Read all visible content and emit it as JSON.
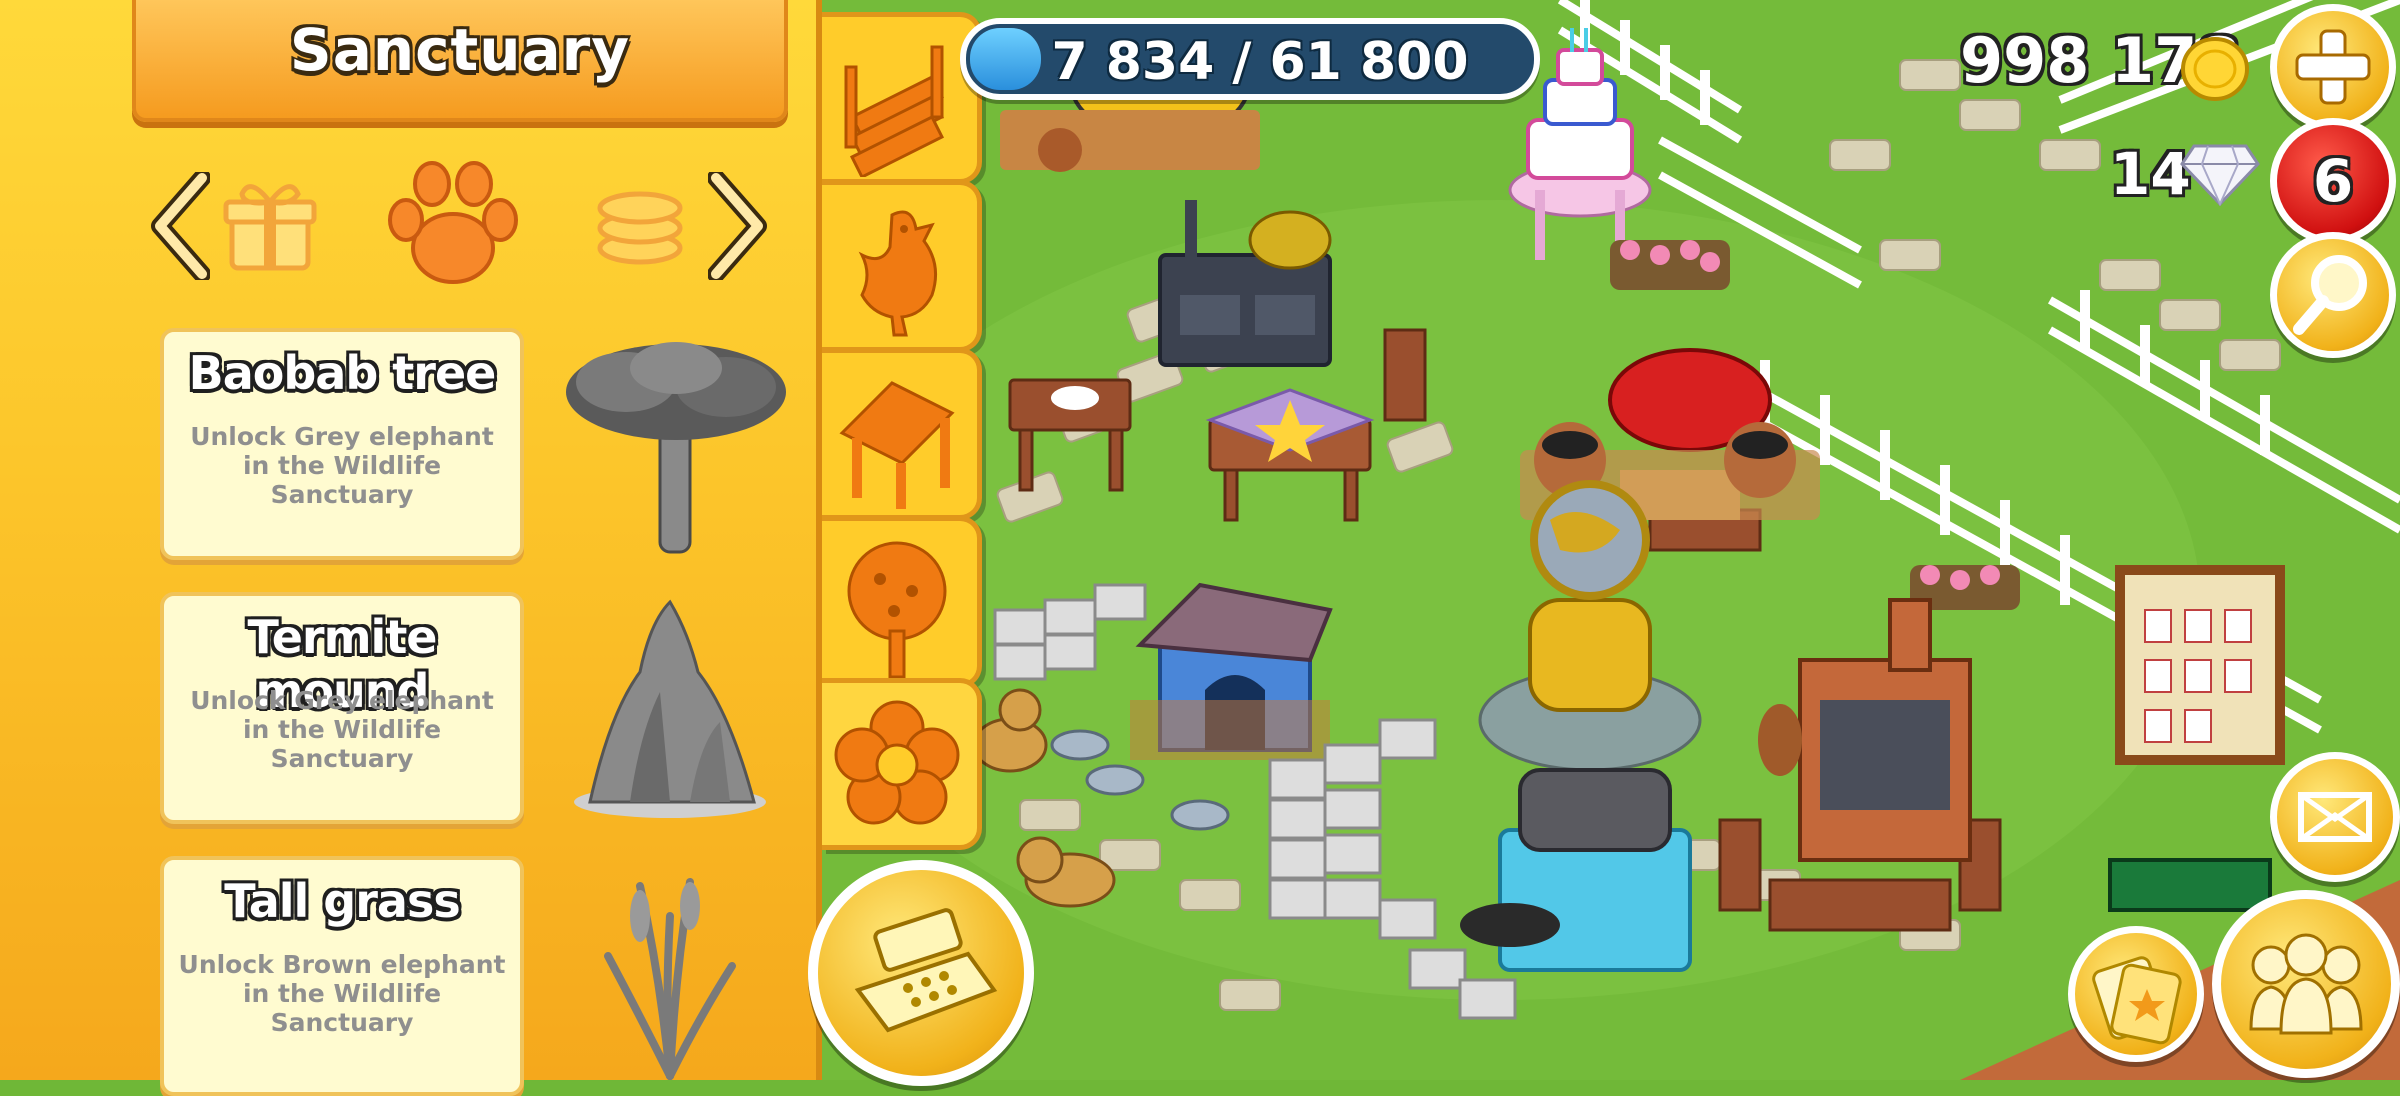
{
  "shop": {
    "title": "Sanctuary",
    "categories": [
      "gift-icon",
      "paw-icon",
      "coins-icon"
    ],
    "active_category": "paw-icon",
    "items": [
      {
        "name": "Baobab tree",
        "description": "Unlock Grey elephant in the Wildlife Sanctuary",
        "icon": "baobab-tree-icon"
      },
      {
        "name": "Termite mound",
        "description": "Unlock Grey elephant in the Wildlife Sanctuary",
        "icon": "termite-mound-icon"
      },
      {
        "name": "Tall grass",
        "description": "Unlock Brown elephant in the Wildlife Sanctuary",
        "icon": "tall-grass-icon"
      }
    ]
  },
  "tabs": [
    "fence-tab-icon",
    "chicken-tab-icon",
    "gazebo-tab-icon",
    "tree-tab-icon",
    "flower-tab-icon"
  ],
  "xp": {
    "text": "7 834 / 61 800",
    "progress": 0.127
  },
  "currency": {
    "coins": "998 178",
    "diamonds": "14",
    "notifications": "6"
  },
  "colors": {
    "panel": "#fcc52a",
    "accent": "#f59b1f",
    "grass": "#6fb737",
    "badge": "#e02020"
  }
}
